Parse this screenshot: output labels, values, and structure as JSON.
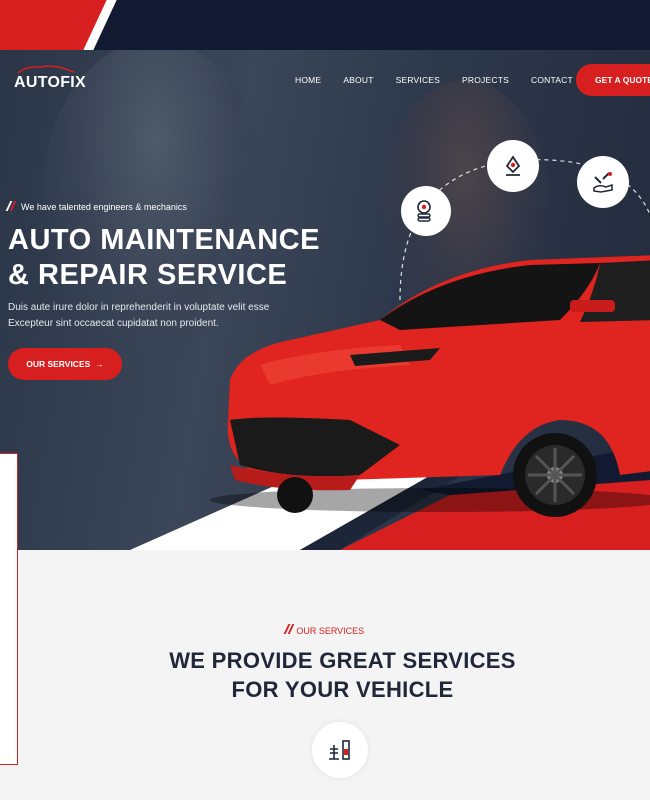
{
  "brand": {
    "logo_text": "AUTOFIX"
  },
  "nav": {
    "items": [
      {
        "label": "HOME"
      },
      {
        "label": "ABOUT"
      },
      {
        "label": "SERVICES"
      },
      {
        "label": "PROJECTS"
      },
      {
        "label": "CONTACT"
      }
    ],
    "quote_label": "GET A QUOTE"
  },
  "hero": {
    "tagline": "We have talented engineers & mechanics",
    "headline_line1": "AUTO MAINTENANCE",
    "headline_line2": "& REPAIR SERVICE",
    "description_line1": "Duis aute irure dolor in reprehenderit in voluptate velit esse",
    "description_line2": "Excepteur sint occaecat cupidatat non proident.",
    "cta_label": "OUR SERVICES",
    "service_icons": [
      "wheel-badge-icon",
      "car-jack-icon",
      "wrench-hand-icon"
    ]
  },
  "services": {
    "tag": "OUR SERVICES",
    "title_line1": "WE PROVIDE GREAT SERVICES",
    "title_line2": "FOR YOUR VEHICLE",
    "icon": "engine-lift-icon"
  },
  "colors": {
    "accent": "#d71f1f",
    "dark": "#111a30",
    "title": "#1f2738"
  }
}
